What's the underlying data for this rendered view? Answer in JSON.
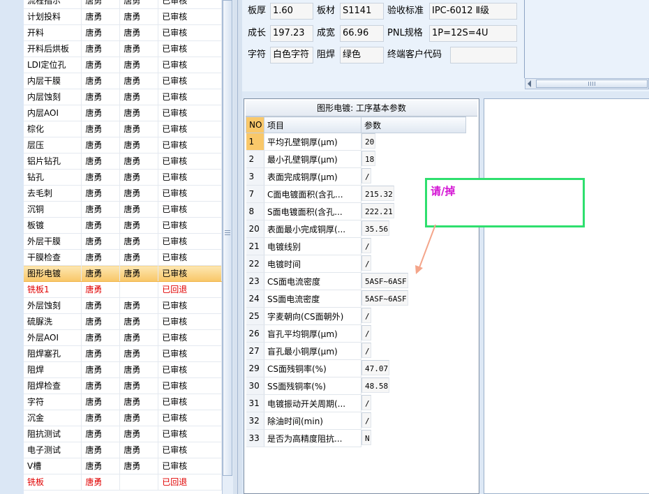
{
  "process_list": {
    "rows": [
      {
        "name": "流程指示",
        "a": "唐勇",
        "b": "唐勇",
        "status": "已审核"
      },
      {
        "name": "计划投料",
        "a": "唐勇",
        "b": "唐勇",
        "status": "已审核"
      },
      {
        "name": "开料",
        "a": "唐勇",
        "b": "唐勇",
        "status": "已审核"
      },
      {
        "name": "开料后烘板",
        "a": "唐勇",
        "b": "唐勇",
        "status": "已审核"
      },
      {
        "name": "LDI定位孔",
        "a": "唐勇",
        "b": "唐勇",
        "status": "已审核"
      },
      {
        "name": "内层干膜",
        "a": "唐勇",
        "b": "唐勇",
        "status": "已审核"
      },
      {
        "name": "内层蚀刻",
        "a": "唐勇",
        "b": "唐勇",
        "status": "已审核"
      },
      {
        "name": "内层AOI",
        "a": "唐勇",
        "b": "唐勇",
        "status": "已审核"
      },
      {
        "name": "棕化",
        "a": "唐勇",
        "b": "唐勇",
        "status": "已审核"
      },
      {
        "name": "层压",
        "a": "唐勇",
        "b": "唐勇",
        "status": "已审核"
      },
      {
        "name": "铝片钻孔",
        "a": "唐勇",
        "b": "唐勇",
        "status": "已审核"
      },
      {
        "name": "钻孔",
        "a": "唐勇",
        "b": "唐勇",
        "status": "已审核"
      },
      {
        "name": "去毛刺",
        "a": "唐勇",
        "b": "唐勇",
        "status": "已审核"
      },
      {
        "name": "沉铜",
        "a": "唐勇",
        "b": "唐勇",
        "status": "已审核"
      },
      {
        "name": "板镀",
        "a": "唐勇",
        "b": "唐勇",
        "status": "已审核"
      },
      {
        "name": "外层干膜",
        "a": "唐勇",
        "b": "唐勇",
        "status": "已审核"
      },
      {
        "name": "干膜检查",
        "a": "唐勇",
        "b": "唐勇",
        "status": "已审核"
      },
      {
        "name": "图形电镀",
        "a": "唐勇",
        "b": "唐勇",
        "status": "已审核",
        "selected": true
      },
      {
        "name": "铣板1",
        "a": "唐勇",
        "b": "",
        "status": "已回退",
        "rejected": true
      },
      {
        "name": "外层蚀刻",
        "a": "唐勇",
        "b": "唐勇",
        "status": "已审核"
      },
      {
        "name": "硫脲洗",
        "a": "唐勇",
        "b": "唐勇",
        "status": "已审核"
      },
      {
        "name": "外层AOI",
        "a": "唐勇",
        "b": "唐勇",
        "status": "已审核"
      },
      {
        "name": "阻焊塞孔",
        "a": "唐勇",
        "b": "唐勇",
        "status": "已审核"
      },
      {
        "name": "阻焊",
        "a": "唐勇",
        "b": "唐勇",
        "status": "已审核"
      },
      {
        "name": "阻焊检查",
        "a": "唐勇",
        "b": "唐勇",
        "status": "已审核"
      },
      {
        "name": "字符",
        "a": "唐勇",
        "b": "唐勇",
        "status": "已审核"
      },
      {
        "name": "沉金",
        "a": "唐勇",
        "b": "唐勇",
        "status": "已审核"
      },
      {
        "name": "阻抗测试",
        "a": "唐勇",
        "b": "唐勇",
        "status": "已审核"
      },
      {
        "name": "电子测试",
        "a": "唐勇",
        "b": "唐勇",
        "status": "已审核"
      },
      {
        "name": "V槽",
        "a": "唐勇",
        "b": "唐勇",
        "status": "已审核"
      },
      {
        "name": "铣板",
        "a": "唐勇",
        "b": "",
        "status": "已回退",
        "rejected": true
      }
    ]
  },
  "info": {
    "board_thickness_label": "板厚",
    "board_thickness": "1.60",
    "material_label": "板材",
    "material": "S1141",
    "acceptance_label": "验收标准",
    "acceptance": "IPC-6012 Ⅱ级",
    "length_label": "成长",
    "length": "197.23",
    "width_label": "成宽",
    "width": "66.96",
    "pnl_label": "PNL规格",
    "pnl": "1P=12S=4U",
    "legend_label": "字符",
    "legend": "白色字符",
    "mask_label": "阻焊",
    "mask": "绿色",
    "customer_code_label": "终端客户代码",
    "customer_code": ""
  },
  "params": {
    "title": "图形电镀: 工序基本参数",
    "col_no": "NO",
    "col_item": "项目",
    "col_value": "参数",
    "rows": [
      {
        "no": "1",
        "item": "平均孔壁铜厚(μm)",
        "value": "20",
        "current": true
      },
      {
        "no": "2",
        "item": "最小孔壁铜厚(μm)",
        "value": "18"
      },
      {
        "no": "3",
        "item": "表面完成铜厚(μm)",
        "value": "/"
      },
      {
        "no": "7",
        "item": "C面电镀面积(含孔...",
        "value": "215.32"
      },
      {
        "no": "8",
        "item": "S面电镀面积(含孔...",
        "value": "222.21"
      },
      {
        "no": "20",
        "item": "表面最小完成铜厚(...",
        "value": "35.56"
      },
      {
        "no": "21",
        "item": "电镀线别",
        "value": "/"
      },
      {
        "no": "22",
        "item": "电镀时间",
        "value": "/"
      },
      {
        "no": "23",
        "item": "CS面电流密度",
        "value": "5ASF~6ASF"
      },
      {
        "no": "24",
        "item": "SS面电流密度",
        "value": "5ASF~6ASF"
      },
      {
        "no": "25",
        "item": "字麦朝向(CS面朝外)",
        "value": "/"
      },
      {
        "no": "26",
        "item": "盲孔平均铜厚(μm)",
        "value": "/"
      },
      {
        "no": "27",
        "item": "盲孔最小铜厚(μm)",
        "value": "/"
      },
      {
        "no": "29",
        "item": "CS面残铜率(%)",
        "value": "47.07"
      },
      {
        "no": "30",
        "item": "SS面残铜率(%)",
        "value": "48.58"
      },
      {
        "no": "31",
        "item": "电镀振动开关周期(...",
        "value": "/"
      },
      {
        "no": "32",
        "item": "除油时间(min)",
        "value": "/"
      },
      {
        "no": "33",
        "item": "是否为高精度阻抗...",
        "value": "N"
      }
    ]
  },
  "annotation": {
    "text": "请/掉",
    "box_color": "#2edf6e",
    "text_color": "#d413d4",
    "arrow_color": "#f4a58a"
  },
  "colors": {
    "selected_row": "#f8c667",
    "rejected_text": "#e00000",
    "panel_bg": "#eaf2fb"
  }
}
